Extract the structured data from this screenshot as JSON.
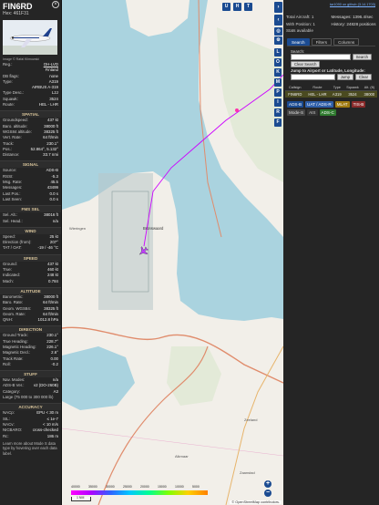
{
  "aircraft": {
    "callsign": "FIN6RD",
    "hex": "Hex: 461F31",
    "image_caption": "Image © Rafal Klimowski"
  },
  "top_rows": [
    {
      "k": "Reg.:",
      "v": "OH-LVD",
      "link": true
    },
    {
      "k": "",
      "v": "Finland"
    },
    {
      "k": "DB flags:",
      "v": "none"
    },
    {
      "k": "Type:",
      "v": "A319"
    },
    {
      "k": "",
      "v": "AIRBUS A-319"
    },
    {
      "k": "Type Desc.:",
      "v": "L2J"
    },
    {
      "k": "Squawk:",
      "v": "3524"
    },
    {
      "k": "Route:",
      "v": "HEL - LHR"
    }
  ],
  "sections": [
    {
      "title": "SPATIAL",
      "rows": [
        {
          "k": "Groundspeed:",
          "v": "437 kt"
        },
        {
          "k": "Baro. altitude:",
          "v": "38000 ft"
        },
        {
          "k": "WGS84 altitude:",
          "v": "38325 ft"
        },
        {
          "k": "Vert. Rate:",
          "v": "64 ft/min"
        },
        {
          "k": "Track:",
          "v": "230.1°"
        },
        {
          "k": "Pos.:",
          "v": "52.864°, 5.132°"
        },
        {
          "k": "Distance:",
          "v": "33.7 nmi"
        }
      ]
    },
    {
      "title": "SIGNAL",
      "rows": [
        {
          "k": "Source:",
          "v": "ADS-B"
        },
        {
          "k": "RSSI:",
          "v": "-5.3"
        },
        {
          "k": "Msg. Rate:",
          "v": "45.5"
        },
        {
          "k": "Messages:",
          "v": "43499"
        },
        {
          "k": "Last Pos.:",
          "v": "0.0 s"
        },
        {
          "k": "Last Seen:",
          "v": "0.0 s"
        }
      ]
    },
    {
      "title": "FMS SEL",
      "rows": [
        {
          "k": "Sel. Alt.:",
          "v": "38016 ft"
        },
        {
          "k": "Sel. Head.:",
          "v": "n/a"
        }
      ]
    },
    {
      "title": "WIND",
      "rows": [
        {
          "k": "Speed:",
          "v": "25 kt"
        },
        {
          "k": "Direction (from):",
          "v": "207°"
        },
        {
          "k": "TAT / OAT:",
          "v": "-19 / -46 °C"
        }
      ]
    },
    {
      "title": "SPEED",
      "rows": [
        {
          "k": "Ground:",
          "v": "437 kt"
        },
        {
          "k": "True:",
          "v": "460 kt"
        },
        {
          "k": "Indicated:",
          "v": "248 kt"
        },
        {
          "k": "Mach:",
          "v": "0.784"
        }
      ]
    },
    {
      "title": "ALTITUDE",
      "rows": [
        {
          "k": "Barometric:",
          "v": "38000 ft"
        },
        {
          "k": "Baro. Rate:",
          "v": "64 ft/min"
        },
        {
          "k": "Geom. WGS84:",
          "v": "38325 ft"
        },
        {
          "k": "Geom. Rate:",
          "v": "64 ft/min"
        },
        {
          "k": "QNH:",
          "v": "1012.8 hPa"
        }
      ]
    },
    {
      "title": "DIRECTION",
      "rows": [
        {
          "k": "Ground Track:",
          "v": "230.1°"
        },
        {
          "k": "True Heading:",
          "v": "228.7°"
        },
        {
          "k": "Magnetic Heading:",
          "v": "226.1°"
        },
        {
          "k": "Magnetic Decl.:",
          "v": "2.6°"
        },
        {
          "k": "Track Rate:",
          "v": "0.00"
        },
        {
          "k": "Roll:",
          "v": "-0.2"
        }
      ]
    },
    {
      "title": "STUFF",
      "rows": [
        {
          "k": "Nav. Modes:",
          "v": "n/a"
        },
        {
          "k": "ADS-B Ver.:",
          "v": "v2 (DO-260B)"
        },
        {
          "k": "Category:",
          "v": "A3"
        },
        {
          "k": "Large (75 000 to 300 000 lb)",
          "v": ""
        }
      ]
    },
    {
      "title": "ACCURACY",
      "rows": [
        {
          "k": "NACp:",
          "v": "EPU < 30 m"
        },
        {
          "k": "SIL:",
          "v": "≤ 1e-7"
        },
        {
          "k": "NACv:",
          "v": "< 10 m/s"
        },
        {
          "k": "NICBARO:",
          "v": "cross-checked"
        },
        {
          "k": "Rc:",
          "v": "186 m"
        }
      ]
    }
  ],
  "footer_note": "Learn more about Mode S data type by hovering over each data label.",
  "map": {
    "toolbar": [
      "U",
      "H",
      "T"
    ],
    "side_buttons": [
      "L",
      "O",
      "K",
      "M",
      "P",
      "I",
      "R",
      "F"
    ],
    "attribution": "© OpenStreetMap contributors.",
    "place_labels": [
      "Alkmaar",
      "Bronswaard",
      "Wieringen",
      "Zaanstad",
      "Zeeland"
    ],
    "scale_label": "1 NM",
    "alt_scale": [
      "40000",
      "35000",
      "30000",
      "25000",
      "20000",
      "15000",
      "10000",
      "5000"
    ],
    "colors": {
      "track": "#cc00ff",
      "water": "#aad3df",
      "land": "#f2efe9"
    }
  },
  "panel": {
    "link": "tar1090 on github (3.14.1703)",
    "stats": [
      {
        "a": "Total Aircraft: 1",
        "b": "Messages: 1396.4/sec"
      },
      {
        "a": "With Position: 1",
        "b": "History: 24828 positions"
      },
      {
        "a": "Stats available",
        "b": ""
      }
    ],
    "tabs": [
      "Search",
      "Filters",
      "Columns"
    ],
    "search_label": "Search:",
    "search_btn": "Search",
    "clear_btn": "Clear Search",
    "jump_label": "Jump to Airport or Latitude, Longitude:",
    "jump_btn": "Jump",
    "jump_clear": "Clear",
    "headers": [
      "Callsign",
      "Route",
      "Type",
      "Squawk",
      "Alt. (ft)"
    ],
    "row": [
      "FIN6RD",
      "HEL - LHR",
      "A319",
      "3524",
      "38000"
    ],
    "chips": [
      {
        "t": "ADS-B",
        "bg": "#1b4b91",
        "fg": "#fff"
      },
      {
        "t": "UAT / ADS-R",
        "bg": "#2e5ea8",
        "fg": "#fff"
      },
      {
        "t": "MLAT",
        "bg": "#a07a10",
        "fg": "#fff"
      },
      {
        "t": "TIS-B",
        "bg": "#8a2a2a",
        "fg": "#fff"
      },
      {
        "t": "Mode-S",
        "bg": "#444",
        "fg": "#ddd"
      },
      {
        "t": "AIS",
        "bg": "#333",
        "fg": "#ccc"
      },
      {
        "t": "ADS-C",
        "bg": "#2f7a2f",
        "fg": "#fff"
      }
    ]
  }
}
